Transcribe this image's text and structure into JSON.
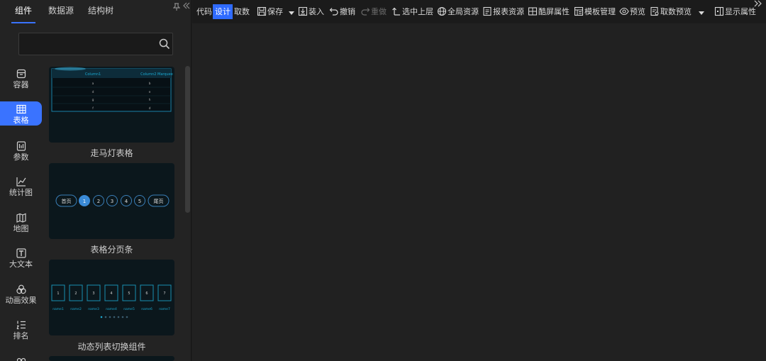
{
  "panel_tabs": [
    "组件",
    "数据源",
    "结构树"
  ],
  "search": {
    "placeholder": ""
  },
  "categories": [
    "容器",
    "表格",
    "参数",
    "统计图",
    "地图",
    "大文本",
    "动画效果",
    "排名"
  ],
  "cards": [
    {
      "title": "走马灯表格",
      "preview": {
        "headers": [
          "Column1",
          "Column2 Marquee"
        ],
        "rows": [
          [
            "a",
            "b"
          ],
          [
            "d",
            "e"
          ],
          [
            "g",
            "h"
          ],
          [
            "f",
            "d"
          ]
        ]
      }
    },
    {
      "title": "表格分页条",
      "preview": {
        "first": "首页",
        "pages": [
          "1",
          "2",
          "3",
          "4",
          "5"
        ],
        "last": "尾页"
      }
    },
    {
      "title": "动态列表切换组件",
      "preview": {
        "boxes": [
          "1",
          "2",
          "3",
          "4",
          "5",
          "6",
          "7"
        ],
        "names": [
          "name1",
          "name2",
          "name3",
          "name4",
          "name5",
          "name6",
          "name7"
        ]
      }
    }
  ],
  "toolbar": {
    "mode_code": "代码",
    "mode_design": "设计",
    "mode_fetch": "取数",
    "save": "保存",
    "load": "装入",
    "undo": "撤销",
    "redo": "重做",
    "select_parent": "选中上层",
    "global_resources": "全局资源",
    "report_resources": "报表资源",
    "screen_props": "酷屏属性",
    "template_mgmt": "模板管理",
    "preview": "预览",
    "fetch_preview": "取数预览",
    "show_props": "显示属性"
  },
  "colors": {
    "accent": "#3a73ff",
    "card_bg": "#0b171c",
    "cyan": "#1aa8c8"
  }
}
